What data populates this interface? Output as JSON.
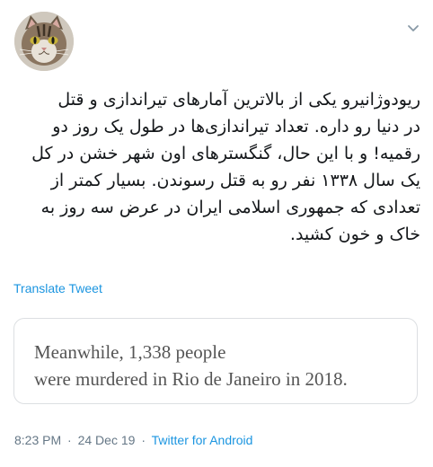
{
  "tweet": {
    "text_lines": [
      "ریودوژانیرو یکی از بالاترین آمارهای تیراندازی و قتل",
      "در دنیا رو داره. تعداد تیراندازی‌ها در طول یک روز دو",
      "رقمیه! و با این حال، گنگسترهای اون شهر خشن در کل",
      "یک سال ۱۳۳۸ نفر رو به قتل رسوندن. بسیار کمتر از",
      "تعدادی که جمهوری اسلامی ایران در عرض سه روز به",
      "خاک و خون کشید."
    ],
    "translate_label": "Translate Tweet",
    "quote_lines": [
      "Meanwhile, 1,338 people",
      "were murdered in Rio de Janeiro in 2018."
    ],
    "time": "8:23 PM",
    "separator": "·",
    "date": "24 Dec 19",
    "source": "Twitter for Android"
  },
  "icons": {
    "avatar": "cat-avatar",
    "menu": "chevron-down-icon"
  },
  "colors": {
    "link": "#1b95e0",
    "meta": "#657786",
    "text": "#14171a",
    "quote_border": "#dcdfe2"
  }
}
